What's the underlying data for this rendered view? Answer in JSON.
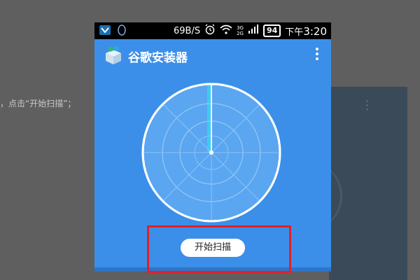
{
  "background": {
    "caption": "，点击“开始扫描”；"
  },
  "statusbar": {
    "speed": "69B/S",
    "network_top": "3G",
    "network_bottom": "2G",
    "battery": "94",
    "time_prefix": "下午",
    "time": "3:20"
  },
  "app": {
    "title": "谷歌安装器",
    "scan_button_label": "开始扫描"
  },
  "colors": {
    "app_blue": "#3c8fe8",
    "highlight_red": "#e41e26",
    "sweep_cyan": "#3ecbf5"
  },
  "icons": [
    "shield-icon",
    "qq-penguin-icon",
    "alarm-icon",
    "wifi-icon",
    "signal-icon",
    "app-logo-icon",
    "more-vert-icon",
    "radar-icon"
  ]
}
